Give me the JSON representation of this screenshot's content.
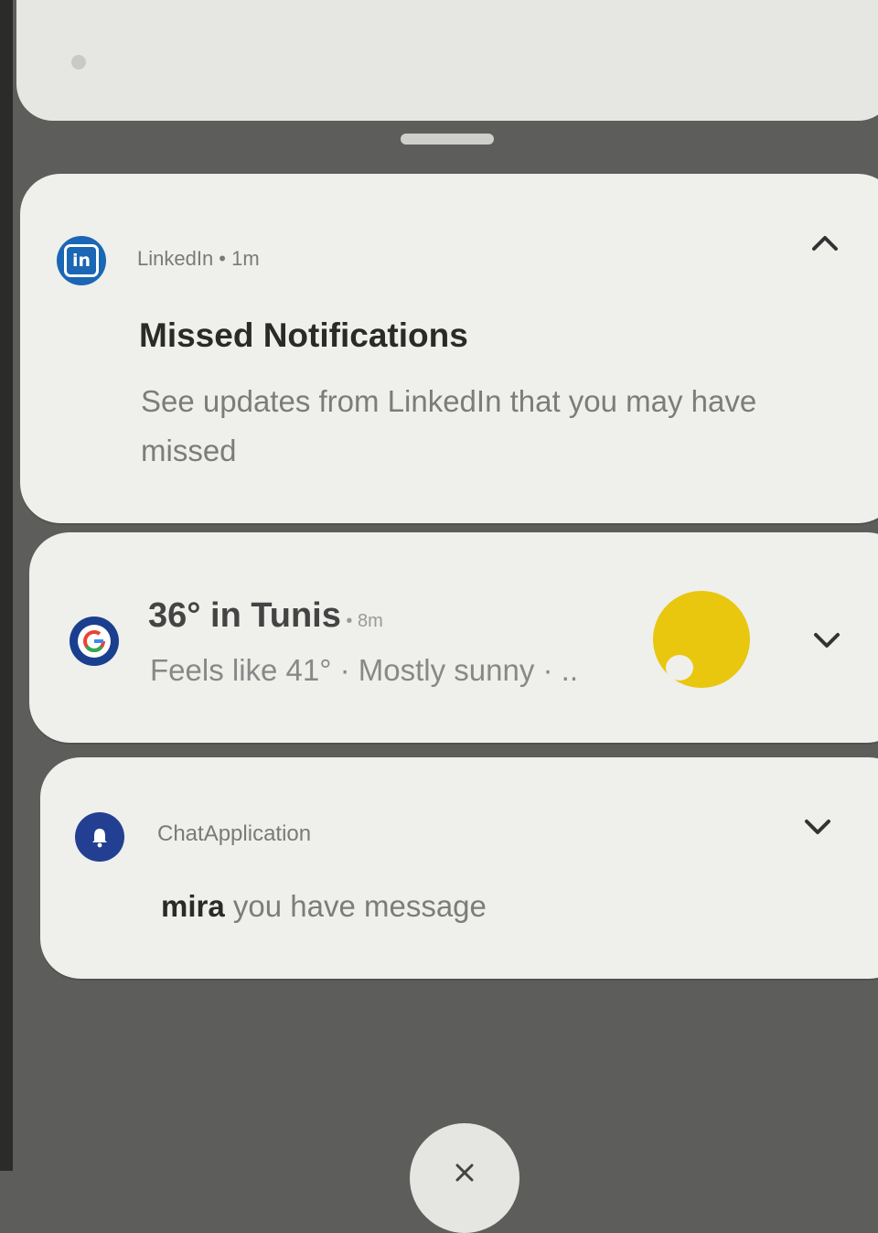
{
  "linkedin": {
    "header": "LinkedIn • 1m",
    "title": "Missed Notifications",
    "body": "See updates from LinkedIn that you may have missed",
    "icon": "linkedin-icon"
  },
  "weather": {
    "title": "36° in Tunis",
    "time": " • 8m",
    "subtitle": "Feels like 41° · Mostly sunny · ..",
    "icon": "google-icon",
    "condition_icon": "sun-icon"
  },
  "chat": {
    "app_name": "ChatApplication",
    "sender": "mira",
    "message": " you have message",
    "icon": "bell-icon"
  },
  "colors": {
    "linkedin_blue": "#1b66b5",
    "google_badge": "#1a3f8f",
    "chat_badge": "#233f92",
    "sun_yellow": "#e8c70e"
  }
}
